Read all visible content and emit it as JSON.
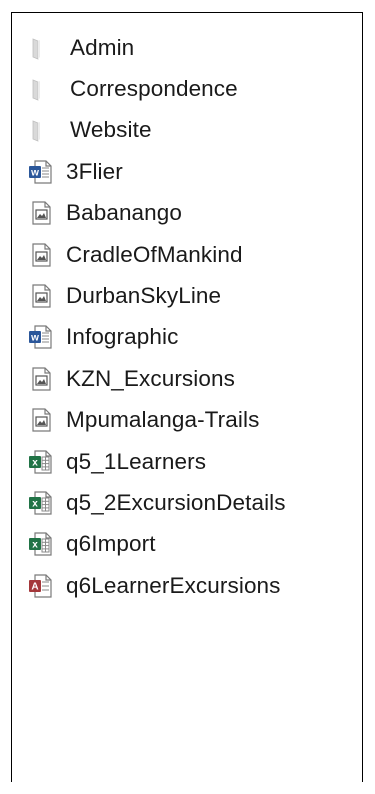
{
  "items": [
    {
      "label": "Admin",
      "type": "folder",
      "icon": "folder-icon"
    },
    {
      "label": "Correspondence",
      "type": "folder",
      "icon": "folder-icon"
    },
    {
      "label": "Website",
      "type": "folder",
      "icon": "folder-icon"
    },
    {
      "label": "3Flier",
      "type": "word",
      "icon": "word-document-icon"
    },
    {
      "label": "Babanango",
      "type": "image",
      "icon": "image-file-icon"
    },
    {
      "label": "CradleOfMankind",
      "type": "image",
      "icon": "image-file-icon"
    },
    {
      "label": "DurbanSkyLine",
      "type": "image",
      "icon": "image-file-icon"
    },
    {
      "label": "Infographic",
      "type": "word",
      "icon": "word-document-icon"
    },
    {
      "label": "KZN_Excursions",
      "type": "image",
      "icon": "image-file-icon"
    },
    {
      "label": "Mpumalanga-Trails",
      "type": "image",
      "icon": "image-file-icon"
    },
    {
      "label": "q5_1Learners",
      "type": "excel",
      "icon": "excel-spreadsheet-icon"
    },
    {
      "label": "q5_2ExcursionDetails",
      "type": "excel",
      "icon": "excel-spreadsheet-icon"
    },
    {
      "label": "q6Import",
      "type": "excel",
      "icon": "excel-spreadsheet-icon"
    },
    {
      "label": "q6LearnerExcursions",
      "type": "access",
      "icon": "access-database-icon"
    }
  ],
  "colors": {
    "folder": "#d9d9d9",
    "word": "#2b579a",
    "excel": "#217346",
    "access": "#a4373a",
    "text": "#1a1a1a"
  }
}
